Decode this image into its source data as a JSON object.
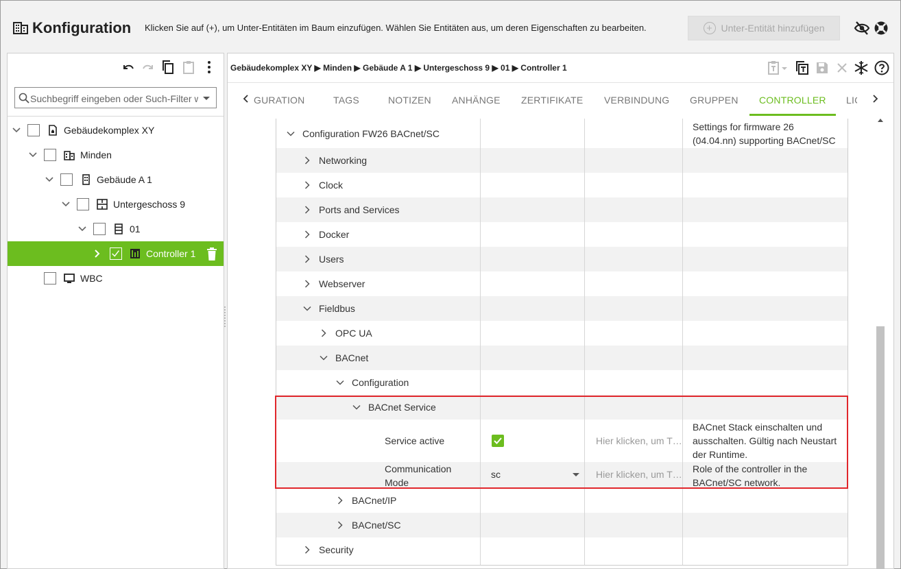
{
  "header": {
    "title": "Konfiguration",
    "hint": "Klicken Sie auf (+), um Unter-Entitäten im Baum einzufügen. Wählen Sie Entitäten aus, um deren Eigenschaften zu bearbeiten.",
    "add_button": "Unter-Entität hinzufügen"
  },
  "left": {
    "search_placeholder": "Suchbegriff eingeben oder Such-Filter wählen",
    "tree": [
      {
        "label": "Gebäudekomplex XY",
        "icon": "building-complex-icon"
      },
      {
        "label": "Minden",
        "icon": "city-icon"
      },
      {
        "label": "Gebäude A 1",
        "icon": "building-icon"
      },
      {
        "label": "Untergeschoss 9",
        "icon": "floor-plan-icon"
      },
      {
        "label": "01",
        "icon": "room-icon"
      },
      {
        "label": "Controller 1",
        "icon": "controller-icon",
        "selected": true,
        "checked": true
      },
      {
        "label": "WBC",
        "icon": "monitor-icon"
      }
    ]
  },
  "breadcrumb": [
    "Gebäudekomplex XY",
    "Minden",
    "Gebäude A 1",
    "Untergeschoss 9",
    "01",
    "Controller 1"
  ],
  "breadcrumb_sep": "▶",
  "tabs": [
    "GURATION",
    "TAGS",
    "NOTIZEN",
    "ANHÄNGE",
    "ZERTIFIKATE",
    "VERBINDUNG",
    "GRUPPEN",
    "CONTROLLER",
    "LIC"
  ],
  "active_tab": "CONTROLLER",
  "grid": {
    "rows": [
      {
        "name": "Configuration FW26 BACnet/SC",
        "desc1": "Settings for firmware 26",
        "desc2": "(04.04.nn) supporting BACnet/SC"
      },
      {
        "name": "Networking"
      },
      {
        "name": "Clock"
      },
      {
        "name": "Ports and Services"
      },
      {
        "name": "Docker"
      },
      {
        "name": "Users"
      },
      {
        "name": "Webserver"
      },
      {
        "name": "Fieldbus"
      },
      {
        "name": "OPC UA"
      },
      {
        "name": "BACnet"
      },
      {
        "name": "Configuration"
      },
      {
        "name": "BACnet Service"
      },
      {
        "name": "Service active",
        "placeholder": "Hier klicken, um T…",
        "desc1": "BACnet Stack einschalten und",
        "desc2": "ausschalten. Gültig nach Neustart",
        "desc3": "der Runtime."
      },
      {
        "name1": "Communication",
        "name2": "Mode",
        "value": "sc",
        "placeholder": "Hier klicken, um T…",
        "desc1": "Role of the controller in the",
        "desc2": "BACnet/SC network."
      },
      {
        "name": "BACnet/IP"
      },
      {
        "name": "BACnet/SC"
      },
      {
        "name": "Security"
      }
    ]
  },
  "colors": {
    "accent": "#6cbd1f",
    "highlight": "#e0262b"
  }
}
